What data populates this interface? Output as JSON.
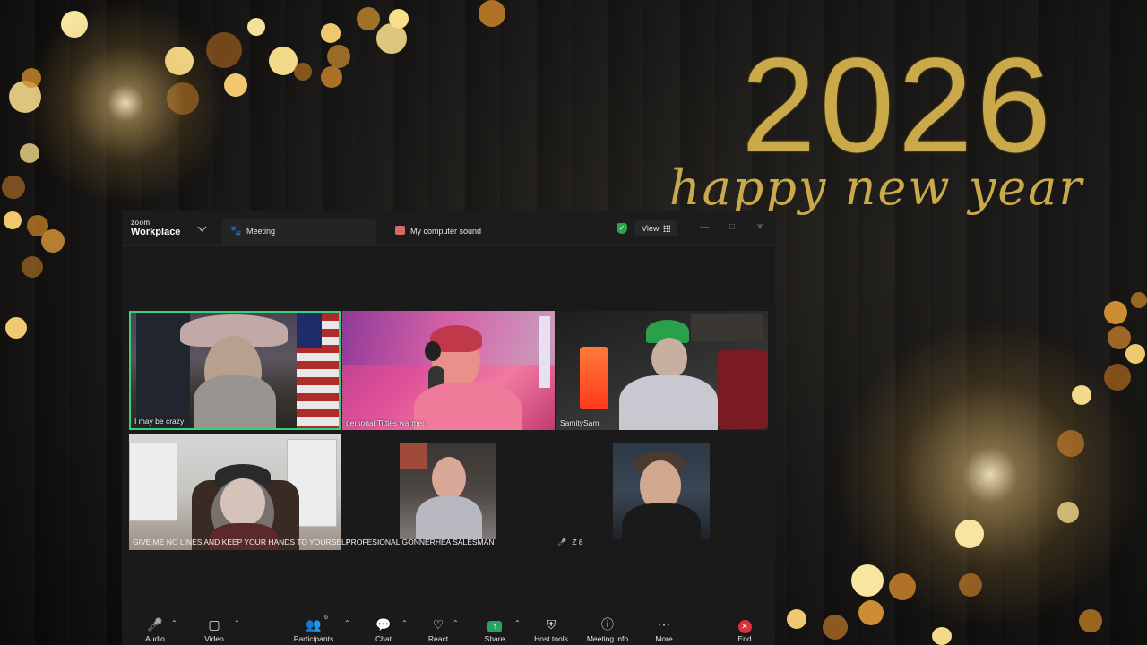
{
  "background": {
    "year": "2026",
    "greeting": "happy new year",
    "accent_color": "#c9a94a"
  },
  "window": {
    "logo_top": "zoom",
    "logo_bottom": "Workplace",
    "tabs": [
      {
        "label": "Meeting",
        "icon": "paw-icon",
        "active": true
      },
      {
        "label": "My computer sound",
        "icon": "computer-sound-icon",
        "active": false
      }
    ],
    "security_icon": "shield-check-icon",
    "view_label": "View",
    "controls": [
      "minimize-icon",
      "maximize-icon",
      "close-icon"
    ]
  },
  "participants": [
    {
      "name": "I may be crazy",
      "speaking": true
    },
    {
      "name": "personal Titties warmer",
      "speaking": false
    },
    {
      "name": "SamitySam",
      "speaking": false
    },
    {
      "name": "GIVE ME NO LINES AND KEEP YOUR HANDS TO YOURSELF",
      "speaking": false
    },
    {
      "name": "PROFESIONAL GONNERHEA SALESMAN",
      "speaking": false
    },
    {
      "name": "Z 8",
      "speaking": false,
      "muted": true
    },
    {
      "name": "",
      "speaking": false
    }
  ],
  "toolbar": {
    "audio": "Audio",
    "video": "Video",
    "participants": "Participants",
    "participants_count": "6",
    "chat": "Chat",
    "react": "React",
    "share": "Share",
    "host_tools": "Host tools",
    "meeting_info": "Meeting info",
    "more": "More",
    "end": "End",
    "share_color": "#25a560",
    "end_color": "#e0303a"
  }
}
